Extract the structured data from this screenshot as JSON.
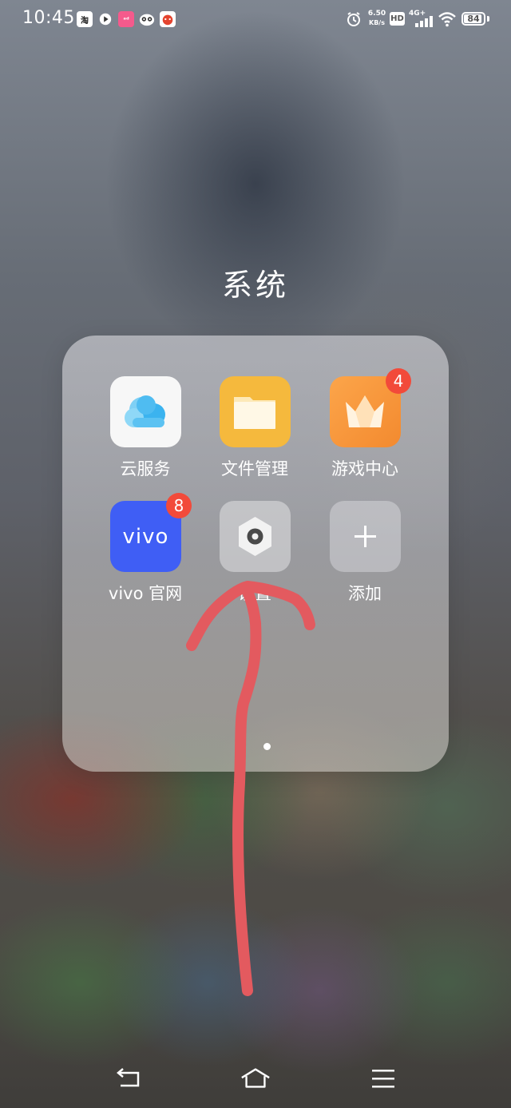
{
  "status_bar": {
    "time": "10:45",
    "notification_icons": [
      "taobao-icon",
      "play-icon",
      "pink-app-icon",
      "owl-app-icon",
      "red-app-icon"
    ],
    "taobao_glyph": "淘",
    "pink_glyph": "ᵃᵈ",
    "net_speed_value": "6.50",
    "net_speed_unit": "KB/s",
    "hd": "HD",
    "network": "4G+",
    "battery_level": "84"
  },
  "folder": {
    "title": "系统",
    "apps": [
      {
        "label": "云服务",
        "icon": "cloud-icon",
        "badge": null
      },
      {
        "label": "文件管理",
        "icon": "folder-icon",
        "badge": null
      },
      {
        "label": "游戏中心",
        "icon": "crown-icon",
        "badge": "4"
      },
      {
        "label": "vivo 官网",
        "icon": "vivo-logo-icon",
        "badge": "8",
        "logo_text": "vivo"
      },
      {
        "label": "设置",
        "icon": "settings-icon",
        "badge": null
      },
      {
        "label": "添加",
        "icon": "plus-icon",
        "badge": null
      }
    ],
    "page_count": 1,
    "current_page": 1
  },
  "nav_bar": {
    "items": [
      "back-icon",
      "home-icon",
      "menu-icon"
    ]
  },
  "colors": {
    "badge": "#f24a3a",
    "annotation_arrow": "#e35a5f",
    "vivo_blue": "#3f5ef5",
    "files_yellow": "#f5b93d",
    "game_orange": "#fb9a3c"
  }
}
